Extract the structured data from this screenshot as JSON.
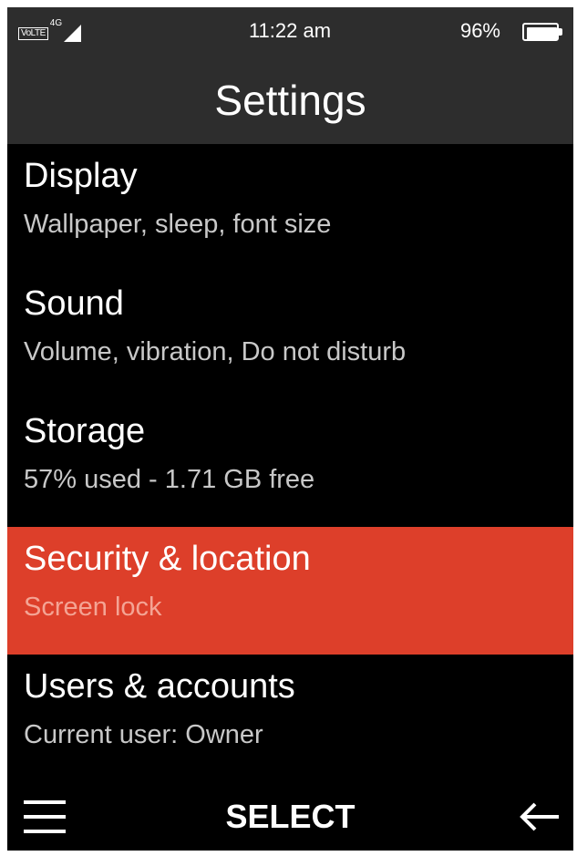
{
  "status_bar": {
    "volte": "VoLTE",
    "network_type": "4G",
    "time": "11:22 am",
    "battery_percent": "96%",
    "battery_level": 0.96,
    "icons": [
      "volte-icon",
      "signal-icon",
      "battery-icon"
    ]
  },
  "header": {
    "title": "Settings"
  },
  "settings": {
    "items": [
      {
        "title": "Display",
        "subtitle": "Wallpaper, sleep, font size",
        "selected": false
      },
      {
        "title": "Sound",
        "subtitle": "Volume, vibration, Do not disturb",
        "selected": false
      },
      {
        "title": "Storage",
        "subtitle": "57% used - 1.71 GB free",
        "selected": false
      },
      {
        "title": "Security & location",
        "subtitle": "Screen lock",
        "selected": true
      },
      {
        "title": "Users & accounts",
        "subtitle": "Current user: Owner",
        "selected": false
      }
    ]
  },
  "softkeys": {
    "left_icon": "menu-icon",
    "center_label": "SELECT",
    "right_icon": "back-arrow-icon"
  },
  "colors": {
    "background": "#000000",
    "header_background": "#2d2d2d",
    "accent": "#dd3f2a",
    "text_primary": "#ffffff",
    "text_secondary": "#c8c8c8",
    "selected_subtitle": "#f4a494"
  }
}
